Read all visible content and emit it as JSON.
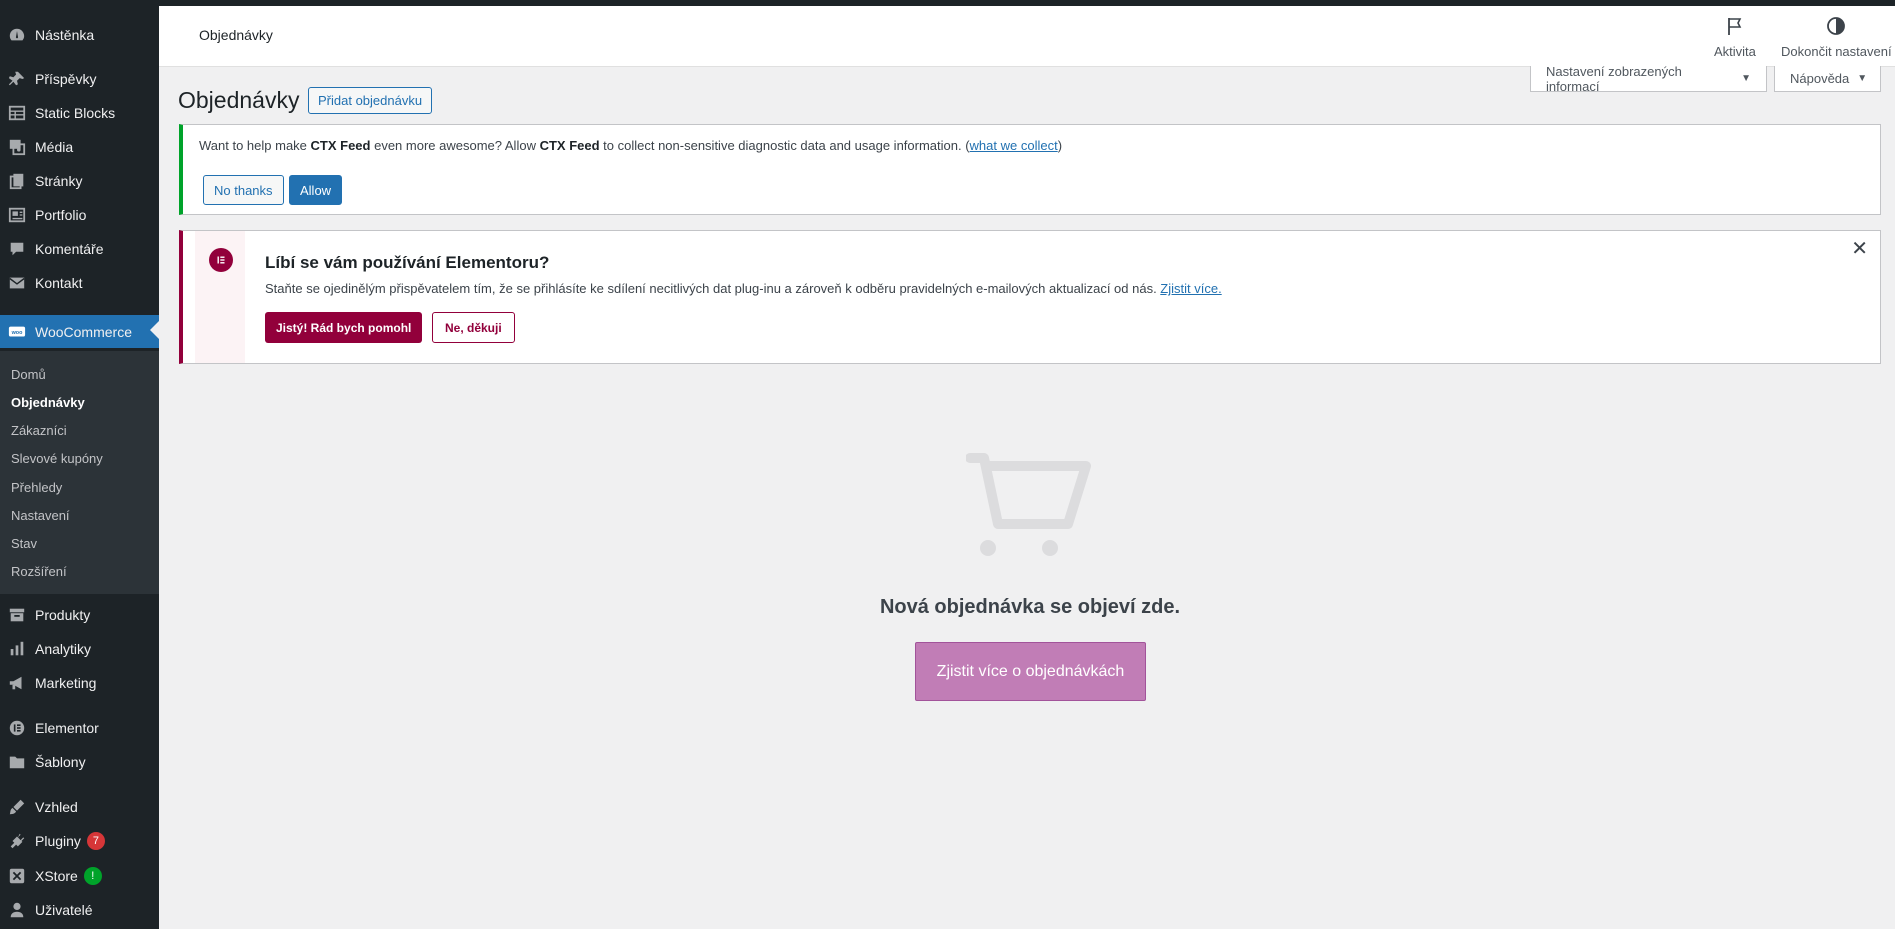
{
  "sidebar": {
    "items": [
      {
        "label": "Nástěnka",
        "icon": "dashboard-icon"
      },
      {
        "label": "Příspěvky",
        "icon": "pin-icon"
      },
      {
        "label": "Static Blocks",
        "icon": "table-icon"
      },
      {
        "label": "Média",
        "icon": "media-icon"
      },
      {
        "label": "Stránky",
        "icon": "pages-icon"
      },
      {
        "label": "Portfolio",
        "icon": "portfolio-icon"
      },
      {
        "label": "Komentáře",
        "icon": "comment-icon"
      },
      {
        "label": "Kontakt",
        "icon": "mail-icon"
      },
      {
        "label": "WooCommerce",
        "icon": "woo-icon"
      },
      {
        "label": "Produkty",
        "icon": "archive-icon"
      },
      {
        "label": "Analytiky",
        "icon": "chart-icon"
      },
      {
        "label": "Marketing",
        "icon": "megaphone-icon"
      },
      {
        "label": "Elementor",
        "icon": "elementor-icon"
      },
      {
        "label": "Šablony",
        "icon": "folder-icon"
      },
      {
        "label": "Vzhled",
        "icon": "brush-icon"
      },
      {
        "label": "Pluginy",
        "icon": "plugin-icon",
        "badge": "7"
      },
      {
        "label": "XStore",
        "icon": "xstore-icon",
        "badge": "!"
      },
      {
        "label": "Uživatelé",
        "icon": "user-icon"
      }
    ],
    "submenu": [
      "Domů",
      "Objednávky",
      "Zákazníci",
      "Slevové kupóny",
      "Přehledy",
      "Nastavení",
      "Stav",
      "Rozšíření"
    ],
    "current_submenu": "Objednávky"
  },
  "header": {
    "title": "Objednávky",
    "activity_label": "Aktivita",
    "finish_setup_label": "Dokončit nastavení"
  },
  "screen_options": {
    "label": "Nastavení zobrazených informací"
  },
  "help": {
    "label": "Nápověda"
  },
  "page": {
    "title": "Objednávky",
    "add_button": "Přidat objednávku"
  },
  "ctx_notice": {
    "text_1": "Want to help make ",
    "brand": "CTX Feed",
    "text_2": " even more awesome? Allow ",
    "text_3": " to collect non-sensitive diagnostic data and usage information. (",
    "link": "what we collect",
    "text_4": ")",
    "no_thanks": "No thanks",
    "allow": "Allow"
  },
  "elementor_notice": {
    "title": "Líbí se vám používání Elementoru?",
    "text": "Staňte se ojedinělým přispěvatelem tím, že se přihlásíte ke sdílení necitlivých dat plug-inu a zároveň k odběru pravidelných e-mailových aktualizací od nás. ",
    "link": "Zjistit více.",
    "yes_button": "Jistý! Rád bych pomohl",
    "no_button": "Ne, děkuji"
  },
  "empty_state": {
    "message": "Nová objednávka se objeví zde.",
    "button": "Zjistit více o objednávkách"
  },
  "colors": {
    "sidebar_bg": "#1d2327",
    "accent": "#2271b1",
    "woo_purple": "#c17db6",
    "elementor": "#92003b",
    "badge_red": "#d63638",
    "badge_green": "#00a32a"
  }
}
